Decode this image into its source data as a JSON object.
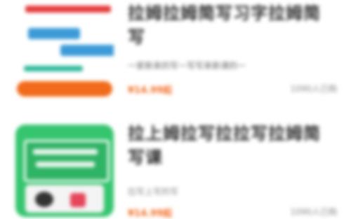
{
  "items": [
    {
      "title": "拉姆拉姆简写习字拉姆简写",
      "subtitle": "一家新来的写一写写来新课的一",
      "price": "¥14.99起",
      "meta": "1090人已购"
    },
    {
      "title": "拉上姆拉写拉拉写拉姆简写课",
      "subtitle": "拉写上写的写",
      "price": "¥14.99起",
      "meta": "1090人已购"
    }
  ],
  "colors": {
    "accent": "#f06a1f",
    "green": "#36c56f",
    "blue": "#3c9ad8",
    "red": "#e53b3b"
  }
}
